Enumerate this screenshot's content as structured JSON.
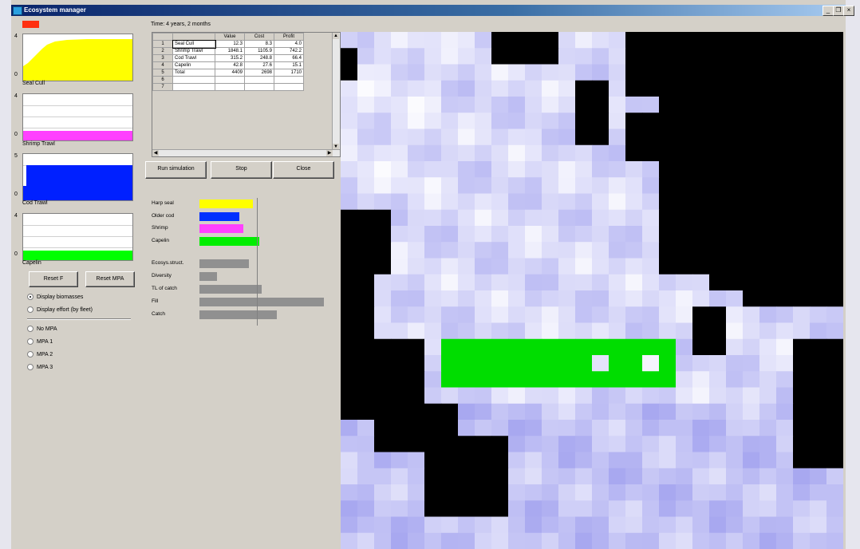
{
  "window": {
    "title": "Ecosystem manager",
    "controls": [
      "_",
      "❐",
      "×"
    ]
  },
  "status": {
    "time_label": "Time: 4 years, 2 months"
  },
  "mini_charts": [
    {
      "label": "Seal Cull",
      "ymax": "4",
      "ymin": "0",
      "color": "#ffff00"
    },
    {
      "label": "Shrimp Trawl",
      "ymax": "4",
      "ymin": "0",
      "color": "#ff40ff"
    },
    {
      "label": "Cod Trawl",
      "ymax": "5",
      "ymin": "0",
      "color": "#0020ff"
    },
    {
      "label": "Capelin",
      "ymax": "4",
      "ymin": "0",
      "color": "#00ff00"
    }
  ],
  "buttons": {
    "reset_f": "Reset F",
    "reset_mpa": "Reset MPA",
    "run": "Run simulation",
    "stop": "Stop",
    "close": "Close"
  },
  "display_options": [
    {
      "label": "Display biomasses",
      "selected": true
    },
    {
      "label": "Display effort (by fleet)",
      "selected": false
    }
  ],
  "mpa_options": [
    {
      "label": "No MPA",
      "selected": false
    },
    {
      "label": "MPA 1",
      "selected": false
    },
    {
      "label": "MPA 2",
      "selected": false
    },
    {
      "label": "MPA 3",
      "selected": false
    }
  ],
  "table": {
    "headers": [
      "",
      "Value",
      "Cost",
      "Profit"
    ],
    "rows": [
      {
        "n": "1",
        "name": "Seal Cull",
        "value": "12.3",
        "cost": "8.3",
        "profit": "4.0"
      },
      {
        "n": "2",
        "name": "Shrimp Trawl",
        "value": "1848.1",
        "cost": "1105.9",
        "profit": "742.2"
      },
      {
        "n": "3",
        "name": "Cod Trawl",
        "value": "315.2",
        "cost": "248.8",
        "profit": "66.4"
      },
      {
        "n": "4",
        "name": "Capelin",
        "value": "42.8",
        "cost": "27.6",
        "profit": "15.1"
      },
      {
        "n": "5",
        "name": "Total",
        "value": "4409",
        "cost": "2698",
        "profit": "1710"
      },
      {
        "n": "6",
        "name": "",
        "value": "",
        "cost": "",
        "profit": ""
      },
      {
        "n": "7",
        "name": "",
        "value": "",
        "cost": "",
        "profit": ""
      }
    ]
  },
  "indicator_bars": [
    {
      "label": "Harp seal",
      "color": "#ffff00",
      "value": 0.43
    },
    {
      "label": "Older cod",
      "color": "#0030ff",
      "value": 0.32
    },
    {
      "label": "Shrimp",
      "color": "#ff40ff",
      "value": 0.35
    },
    {
      "label": "Capelin",
      "color": "#00ee00",
      "value": 0.48
    },
    {
      "label": "Ecosys.struct.",
      "color": "#909090",
      "value": 0.4
    },
    {
      "label": "Diversity",
      "color": "#909090",
      "value": 0.14
    },
    {
      "label": "TL of catch",
      "color": "#909090",
      "value": 0.5
    },
    {
      "label": "Fill",
      "color": "#909090",
      "value": 1.0
    },
    {
      "label": "Catch",
      "color": "#909090",
      "value": 0.62
    }
  ],
  "map_legend_colors": {
    "land": "#000000",
    "mpa": "#00dd00",
    "water_low": "#ffffff",
    "water_high": "#a8a8f0"
  }
}
